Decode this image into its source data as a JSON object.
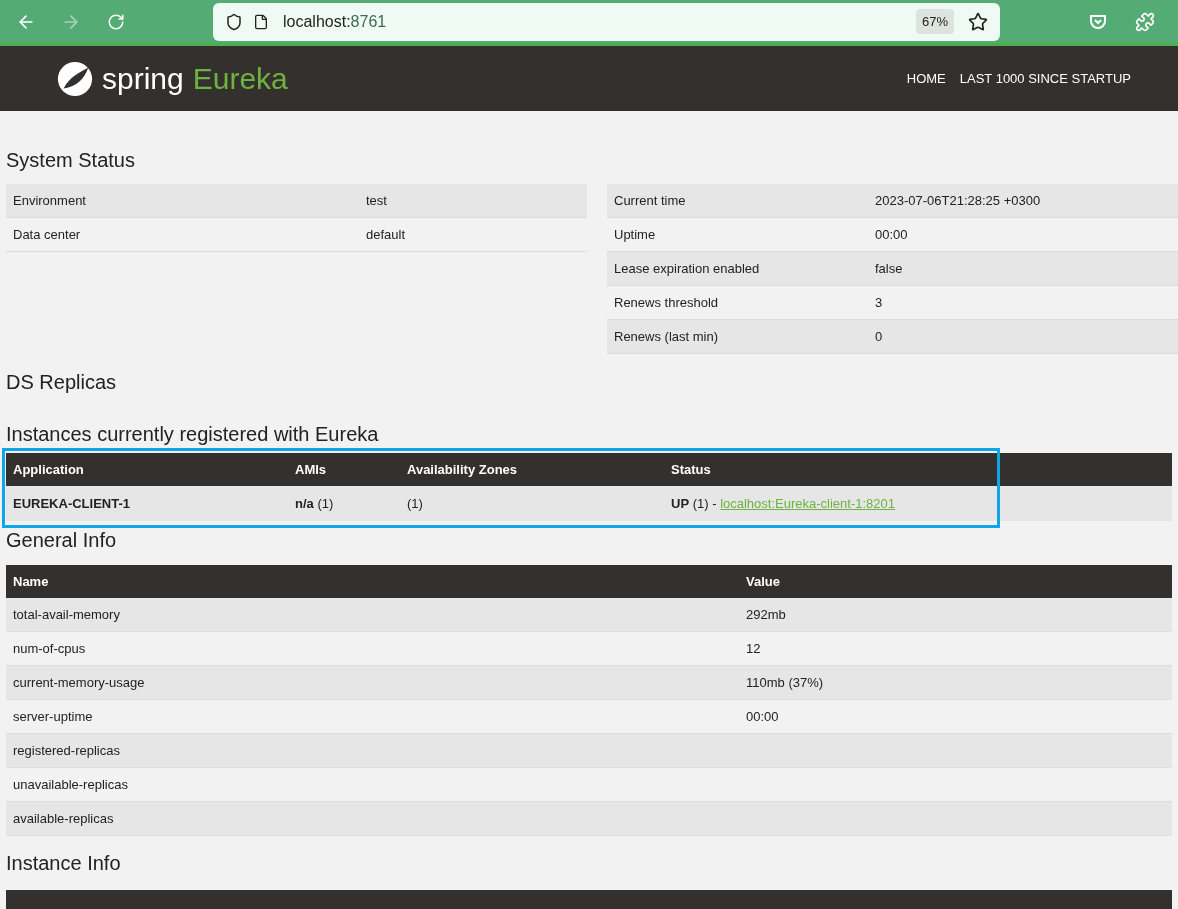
{
  "browser": {
    "url_host": "localhost:",
    "url_port": "8761",
    "zoom": "67%"
  },
  "header": {
    "logo_word": "spring",
    "logo_product": "Eureka",
    "nav": [
      "HOME",
      "LAST 1000 SINCE STARTUP"
    ]
  },
  "system_status": {
    "title": "System Status",
    "left": [
      {
        "label": "Environment",
        "value": "test"
      },
      {
        "label": "Data center",
        "value": "default"
      }
    ],
    "right": [
      {
        "label": "Current time",
        "value": "2023-07-06T21:28:25 +0300"
      },
      {
        "label": "Uptime",
        "value": "00:00"
      },
      {
        "label": "Lease expiration enabled",
        "value": "false"
      },
      {
        "label": "Renews threshold",
        "value": "3"
      },
      {
        "label": "Renews (last min)",
        "value": "0"
      }
    ]
  },
  "ds_replicas": {
    "title": "DS Replicas"
  },
  "instances": {
    "title": "Instances currently registered with Eureka",
    "highlighted": true,
    "columns": [
      "Application",
      "AMIs",
      "Availability Zones",
      "Status"
    ],
    "rows": [
      {
        "application": "EUREKA-CLIENT-1",
        "amis": "**n/a** (1)",
        "zones": "(1)",
        "status": "**UP** (1) - ",
        "link": "localhost:Eureka-client-1:8201"
      }
    ]
  },
  "general_info": {
    "title": "General Info",
    "columns": [
      "Name",
      "Value"
    ],
    "rows": [
      {
        "name": "total-avail-memory",
        "value": "292mb"
      },
      {
        "name": "num-of-cpus",
        "value": "12"
      },
      {
        "name": "current-memory-usage",
        "value": "110mb (37%)"
      },
      {
        "name": "server-uptime",
        "value": "00:00"
      },
      {
        "name": "registered-replicas",
        "value": ""
      },
      {
        "name": "unavailable-replicas",
        "value": ""
      },
      {
        "name": "available-replicas",
        "value": ""
      }
    ]
  },
  "instance_info": {
    "title": "Instance Info"
  }
}
